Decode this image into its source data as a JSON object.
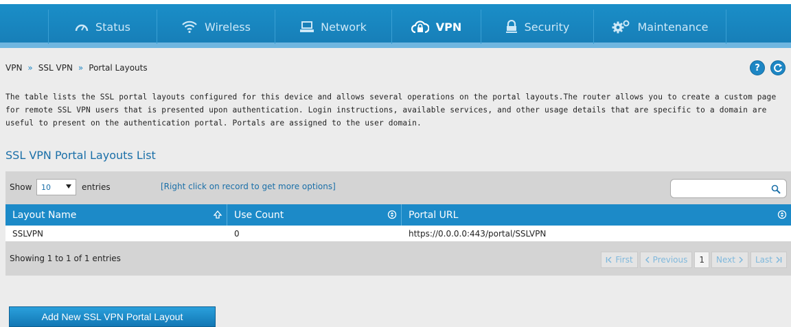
{
  "nav": {
    "items": [
      {
        "label": "Status",
        "icon": "gauge-icon",
        "active": false
      },
      {
        "label": "Wireless",
        "icon": "wifi-icon",
        "active": false
      },
      {
        "label": "Network",
        "icon": "monitor-icon",
        "active": false
      },
      {
        "label": "VPN",
        "icon": "cloud-lock-icon",
        "active": true
      },
      {
        "label": "Security",
        "icon": "padlock-icon",
        "active": false
      },
      {
        "label": "Maintenance",
        "icon": "gears-icon",
        "active": false
      }
    ]
  },
  "breadcrumb": {
    "items": [
      "VPN",
      "SSL VPN",
      "Portal Layouts"
    ],
    "separator": "»"
  },
  "help_icon": "?",
  "description": "The table lists the SSL portal layouts configured for this device and allows several operations on the portal layouts.The router allows you to create a custom page for remote SSL VPN users that is presented upon authentication. Login instructions, available services, and other usage details that are specific to a domain are useful to present on the authentication portal. Portals are assigned to the user domain.",
  "section_title": "SSL VPN Portal Layouts List",
  "table": {
    "show_label": "Show",
    "entries_value": "10",
    "entries_label": "entries",
    "hint": "[Right click on record to get more options]",
    "search_value": "",
    "columns": [
      "Layout Name",
      "Use Count",
      "Portal URL"
    ],
    "rows": [
      [
        "SSLVPN",
        "0",
        "https://0.0.0.0:443/portal/SSLVPN"
      ]
    ],
    "footer_info": "Showing 1 to 1 of 1 entries",
    "pager": {
      "first": "First",
      "previous": "Previous",
      "current": "1",
      "next": "Next",
      "last": "Last"
    }
  },
  "add_button": "Add New SSL VPN Portal Layout",
  "colors": {
    "nav_blue": "#177fb8",
    "header_blue": "#1c8ac8",
    "link_blue": "#1a6fa8"
  }
}
